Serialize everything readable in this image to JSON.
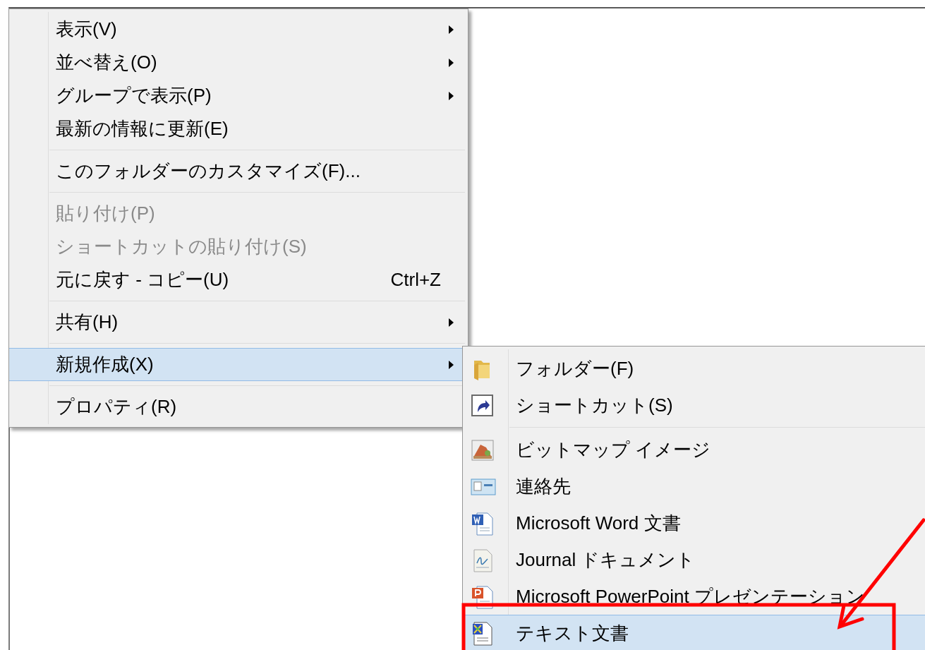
{
  "context_menu": {
    "items": [
      {
        "kind": "item",
        "label": "表示(V)",
        "submenu": true,
        "disabled": false,
        "selected": false
      },
      {
        "kind": "item",
        "label": "並べ替え(O)",
        "submenu": true,
        "disabled": false,
        "selected": false
      },
      {
        "kind": "item",
        "label": "グループで表示(P)",
        "submenu": true,
        "disabled": false,
        "selected": false
      },
      {
        "kind": "item",
        "label": "最新の情報に更新(E)",
        "submenu": false,
        "disabled": false,
        "selected": false
      },
      {
        "kind": "separator"
      },
      {
        "kind": "item",
        "label": "このフォルダーのカスタマイズ(F)...",
        "submenu": false,
        "disabled": false,
        "selected": false
      },
      {
        "kind": "separator"
      },
      {
        "kind": "item",
        "label": "貼り付け(P)",
        "submenu": false,
        "disabled": true,
        "selected": false
      },
      {
        "kind": "item",
        "label": "ショートカットの貼り付け(S)",
        "submenu": false,
        "disabled": true,
        "selected": false
      },
      {
        "kind": "item",
        "label": "元に戻す - コピー(U)",
        "shortcut": "Ctrl+Z",
        "submenu": false,
        "disabled": false,
        "selected": false
      },
      {
        "kind": "separator"
      },
      {
        "kind": "item",
        "label": "共有(H)",
        "submenu": true,
        "disabled": false,
        "selected": false
      },
      {
        "kind": "separator"
      },
      {
        "kind": "item",
        "label": "新規作成(X)",
        "submenu": true,
        "disabled": false,
        "selected": true
      },
      {
        "kind": "separator"
      },
      {
        "kind": "item",
        "label": "プロパティ(R)",
        "submenu": false,
        "disabled": false,
        "selected": false
      }
    ]
  },
  "new_submenu": {
    "items": [
      {
        "kind": "folder",
        "label": "フォルダー(F)",
        "selected": false
      },
      {
        "kind": "shortcut",
        "label": "ショートカット(S)",
        "selected": false
      },
      {
        "kind": "separator"
      },
      {
        "kind": "bitmap",
        "label": "ビットマップ イメージ",
        "selected": false
      },
      {
        "kind": "contact",
        "label": "連絡先",
        "selected": false
      },
      {
        "kind": "word",
        "label": "Microsoft Word 文書",
        "selected": false
      },
      {
        "kind": "journal",
        "label": "Journal ドキュメント",
        "selected": false
      },
      {
        "kind": "powerpoint",
        "label": "Microsoft PowerPoint プレゼンテーション",
        "selected": false
      },
      {
        "kind": "text",
        "label": "テキスト文書",
        "selected": true
      }
    ]
  }
}
